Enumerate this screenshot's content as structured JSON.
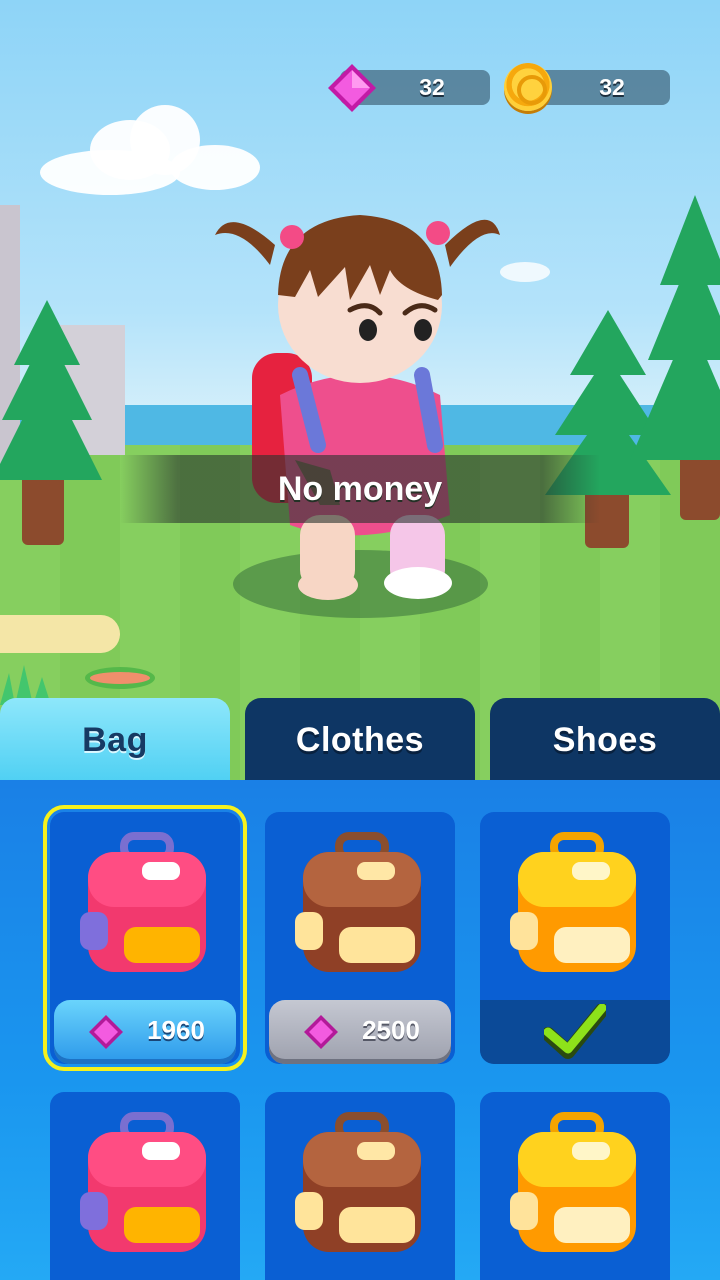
{
  "currency": {
    "gems": "32",
    "coins": "32",
    "gem_icon": "gem-icon",
    "coin_icon": "coin-icon"
  },
  "toast": {
    "message": "No money"
  },
  "tabs": [
    {
      "label": "Bag",
      "active": true
    },
    {
      "label": "Clothes",
      "active": false
    },
    {
      "label": "Shoes",
      "active": false
    }
  ],
  "items": [
    {
      "color": "pink",
      "price": "1960",
      "state": "buy",
      "selected": true
    },
    {
      "color": "brown",
      "price": "2500",
      "state": "locked",
      "selected": false
    },
    {
      "color": "yellow",
      "price": "",
      "state": "owned",
      "selected": false
    },
    {
      "color": "pink",
      "price": "",
      "state": "partial",
      "selected": false
    },
    {
      "color": "brown",
      "price": "",
      "state": "partial",
      "selected": false
    },
    {
      "color": "yellow",
      "price": "",
      "state": "partial",
      "selected": false
    }
  ],
  "colors": {
    "panel": "#1a8aea",
    "card": "#0a5fd3",
    "tab_inactive": "#0e3664",
    "tab_active": "#5fd6f5",
    "selected_outline": "#f5f11e",
    "check": "#8ee21a"
  }
}
